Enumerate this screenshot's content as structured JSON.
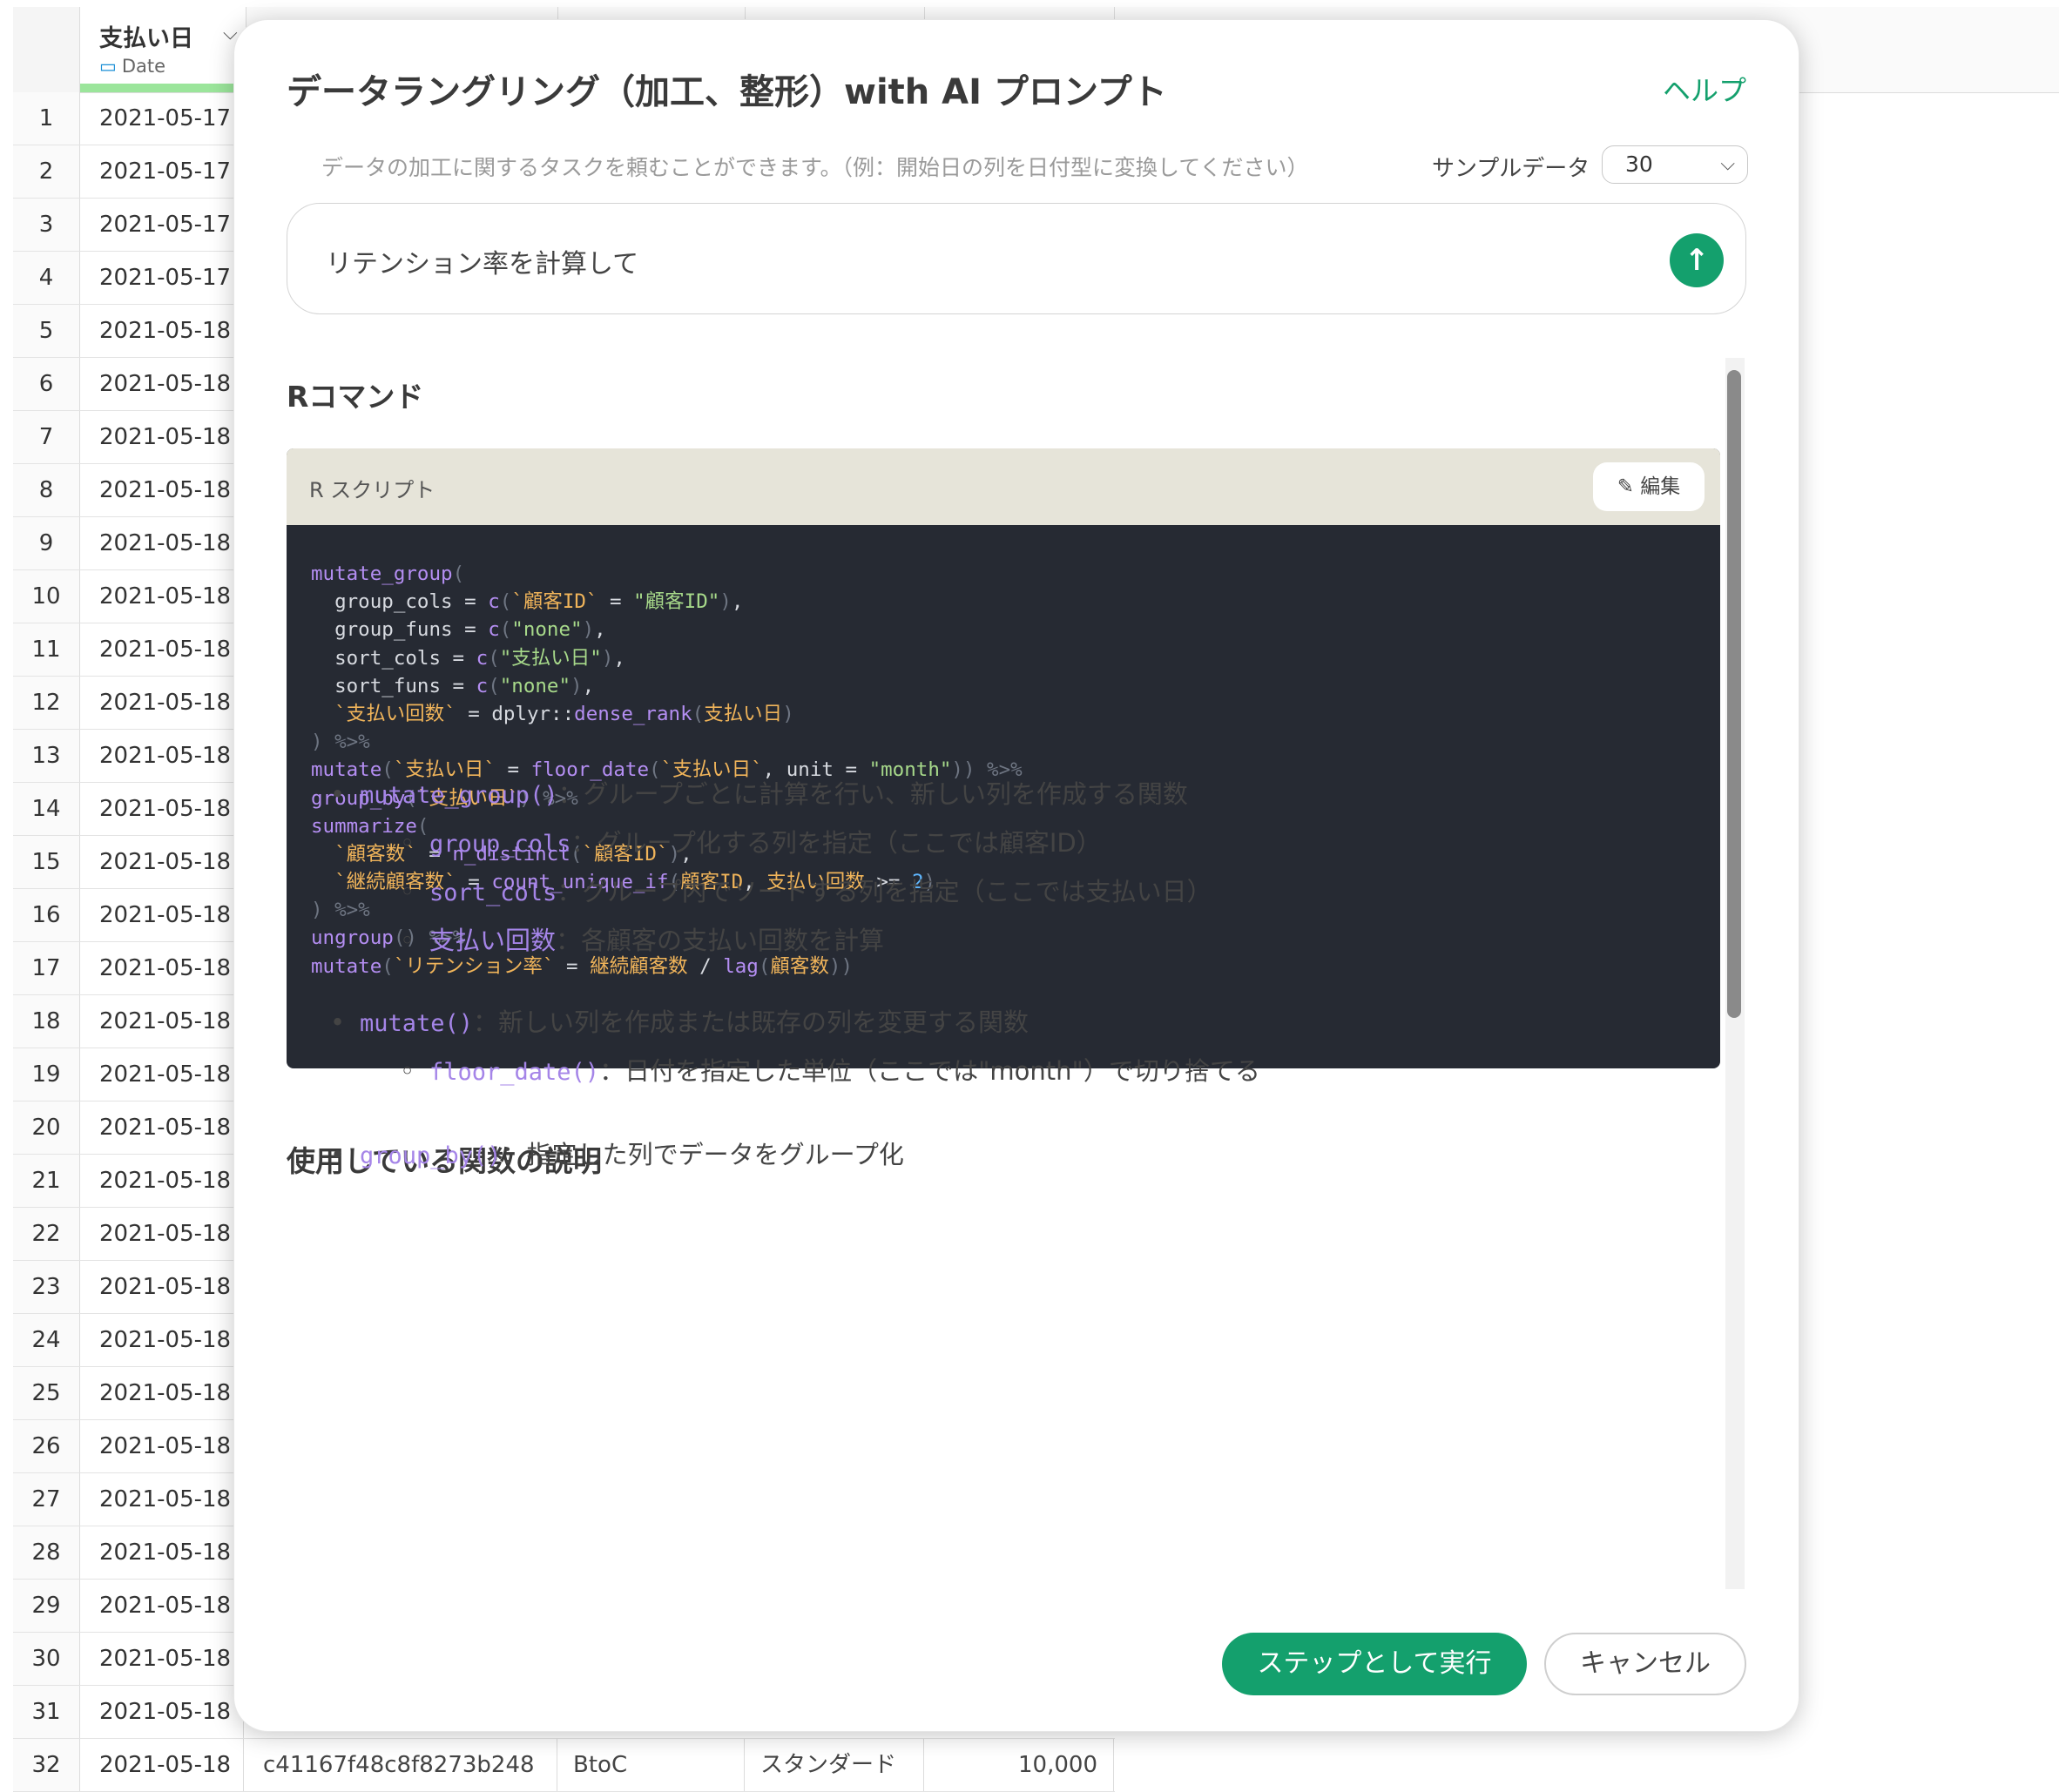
{
  "sheet": {
    "column_title": "支払い日",
    "column_type": "Date",
    "dates": [
      "2021-05-17",
      "2021-05-17",
      "2021-05-17",
      "2021-05-17",
      "2021-05-18",
      "2021-05-18",
      "2021-05-18",
      "2021-05-18",
      "2021-05-18",
      "2021-05-18",
      "2021-05-18",
      "2021-05-18",
      "2021-05-18",
      "2021-05-18",
      "2021-05-18",
      "2021-05-18",
      "2021-05-18",
      "2021-05-18",
      "2021-05-18",
      "2021-05-18",
      "2021-05-18",
      "2021-05-18",
      "2021-05-18",
      "2021-05-18",
      "2021-05-18",
      "2021-05-18",
      "2021-05-18",
      "2021-05-18",
      "2021-05-18",
      "2021-05-18",
      "2021-05-18",
      "2021-05-18"
    ],
    "last_row": {
      "id": "c41167f48c8f8273b248",
      "type": "BtoC",
      "plan": "スタンダード",
      "amount": "10,000"
    }
  },
  "modal": {
    "title": "データラングリング（加工、整形）with AI プロンプト",
    "help": "ヘルプ",
    "hint": "データの加工に関するタスクを頼むことができます。（例：開始日の列を日付型に変換してください）",
    "sample_label": "サンプルデータ",
    "sample_value": "30",
    "prompt": "リテンション率を計算して",
    "r_section_title": "Rコマンド",
    "script_label": "R スクリプト",
    "edit_label": "編集",
    "desc_title": "使用している関数の説明",
    "run_label": "ステップとして実行",
    "cancel_label": "キャンセル"
  },
  "code_lines": [
    [
      [
        "mutate_group",
        "fn"
      ],
      [
        "(",
        "op"
      ]
    ],
    [
      [
        "  group_cols = ",
        "plain"
      ],
      [
        "c",
        "fn"
      ],
      [
        "(",
        "op"
      ],
      [
        "`顧客ID`",
        "bt"
      ],
      [
        " = ",
        "plain"
      ],
      [
        "\"顧客ID\"",
        "str"
      ],
      [
        ")",
        "op"
      ],
      [
        ",",
        "plain"
      ]
    ],
    [
      [
        "  group_funs = ",
        "plain"
      ],
      [
        "c",
        "fn"
      ],
      [
        "(",
        "op"
      ],
      [
        "\"none\"",
        "str"
      ],
      [
        ")",
        "op"
      ],
      [
        ",",
        "plain"
      ]
    ],
    [
      [
        "  sort_cols = ",
        "plain"
      ],
      [
        "c",
        "fn"
      ],
      [
        "(",
        "op"
      ],
      [
        "\"支払い日\"",
        "str"
      ],
      [
        ")",
        "op"
      ],
      [
        ",",
        "plain"
      ]
    ],
    [
      [
        "  sort_funs = ",
        "plain"
      ],
      [
        "c",
        "fn"
      ],
      [
        "(",
        "op"
      ],
      [
        "\"none\"",
        "str"
      ],
      [
        ")",
        "op"
      ],
      [
        ",",
        "plain"
      ]
    ],
    [
      [
        "  ",
        "plain"
      ],
      [
        "`支払い回数`",
        "bt"
      ],
      [
        " = dplyr::",
        "plain"
      ],
      [
        "dense_rank",
        "fn"
      ],
      [
        "(",
        "op"
      ],
      [
        "支払い日",
        "bt"
      ],
      [
        ")",
        "op"
      ]
    ],
    [
      [
        ") %>%",
        "op"
      ]
    ],
    [
      [
        "mutate",
        "fn"
      ],
      [
        "(",
        "op"
      ],
      [
        "`支払い日`",
        "bt"
      ],
      [
        " = ",
        "plain"
      ],
      [
        "floor_date",
        "fn"
      ],
      [
        "(",
        "op"
      ],
      [
        "`支払い日`",
        "bt"
      ],
      [
        ", unit = ",
        "plain"
      ],
      [
        "\"month\"",
        "str"
      ],
      [
        ")) %>%",
        "op"
      ]
    ],
    [
      [
        "group_by",
        "fn"
      ],
      [
        "(",
        "op"
      ],
      [
        "`支払い日`",
        "bt"
      ],
      [
        ") %>%",
        "op"
      ]
    ],
    [
      [
        "summarize",
        "fn"
      ],
      [
        "(",
        "op"
      ]
    ],
    [
      [
        "  ",
        "plain"
      ],
      [
        "`顧客数`",
        "bt"
      ],
      [
        " = ",
        "plain"
      ],
      [
        "n_distinct",
        "fn"
      ],
      [
        "(",
        "op"
      ],
      [
        "`顧客ID`",
        "bt"
      ],
      [
        ")",
        "op"
      ],
      [
        ",",
        "plain"
      ]
    ],
    [
      [
        "  ",
        "plain"
      ],
      [
        "`継続顧客数`",
        "bt"
      ],
      [
        " = ",
        "plain"
      ],
      [
        "count_unique_if",
        "fn"
      ],
      [
        "(",
        "op"
      ],
      [
        "顧客ID",
        "bt"
      ],
      [
        ", ",
        "plain"
      ],
      [
        "支払い回数",
        "bt"
      ],
      [
        " >= ",
        "plain"
      ],
      [
        "2",
        "num"
      ],
      [
        ")",
        "op"
      ]
    ],
    [
      [
        ") %>%",
        "op"
      ]
    ],
    [
      [
        "ungroup",
        "fn"
      ],
      [
        "() %>%",
        "op"
      ]
    ],
    [
      [
        "mutate",
        "fn"
      ],
      [
        "(",
        "op"
      ],
      [
        "`リテンション率`",
        "bt"
      ],
      [
        " = ",
        "plain"
      ],
      [
        "継続顧客数",
        "bt"
      ],
      [
        " / ",
        "plain"
      ],
      [
        "lag",
        "fn"
      ],
      [
        "(",
        "op"
      ],
      [
        "顧客数",
        "bt"
      ],
      [
        "))",
        "op"
      ]
    ]
  ],
  "desc_items": [
    {
      "level": 1,
      "code": "mutate_group()",
      "text": "：グループごとに計算を行い、新しい列を作成する関数"
    },
    {
      "level": 2,
      "code": "group_cols",
      "text": "：グループ化する列を指定（ここでは顧客ID）"
    },
    {
      "level": 2,
      "code": "sort_cols",
      "text": "：グループ内でソートする列を指定（ここでは支払い日）"
    },
    {
      "level": 2,
      "code": "支払い回数",
      "text": "：各顧客の支払い回数を計算",
      "jp": true
    },
    {
      "level": 1,
      "code": "mutate()",
      "text": "：新しい列を作成または既存の列を変更する関数"
    },
    {
      "level": 2,
      "code": "floor_date()",
      "text": "：日付を指定した単位（ここでは\"month\"）で切り捨てる"
    },
    {
      "level": 1,
      "code": "group_by()",
      "text": "：指定した列でデータをグループ化"
    }
  ],
  "colors": {
    "accent": "#14a06d",
    "code_bg": "#262a33",
    "code_header": "#e6e4d9"
  }
}
